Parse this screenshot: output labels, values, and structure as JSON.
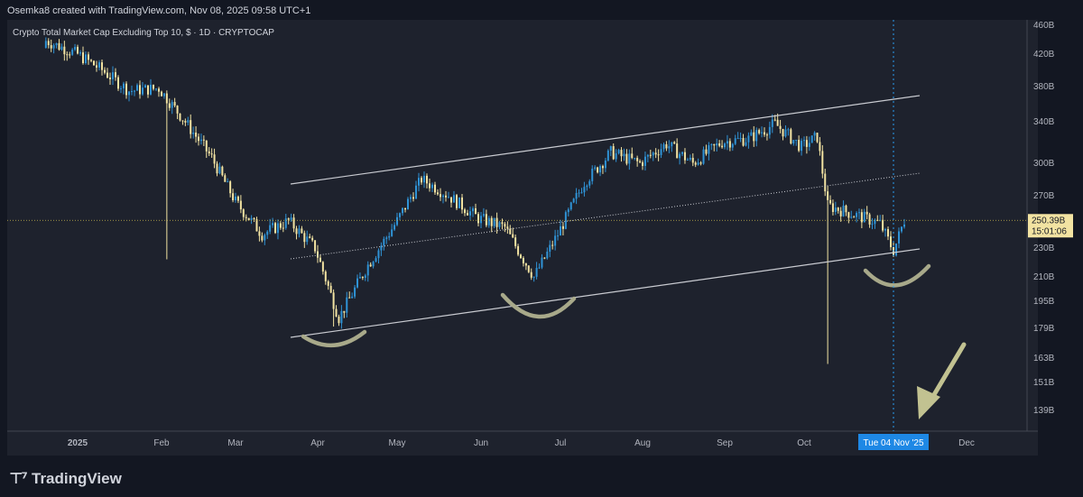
{
  "header": {
    "attribution": "Osemka8 created with TradingView.com, Nov 08, 2025 09:58 UTC+1"
  },
  "brand": {
    "name": "TradingView"
  },
  "colors": {
    "up": "#2f93d6",
    "down": "#f2e3a2",
    "channel": "#c9cbd1",
    "annotation": "#a8a98a",
    "price_line": "#c7b84e",
    "cursor": "#2a9df4"
  },
  "chart_data": {
    "type": "candlestick",
    "title": "Crypto Total Market Cap Excluding Top 10, $ · 1D · CRYPTOCAP",
    "y_ticks": [
      "460B",
      "420B",
      "380B",
      "340B",
      "300B",
      "270B",
      "230B",
      "210B",
      "195B",
      "179B",
      "163B",
      "151B",
      "139B"
    ],
    "y_scale": "log",
    "x_ticks": [
      "2025",
      "Feb",
      "Mar",
      "Apr",
      "May",
      "Jun",
      "Jul",
      "Aug",
      "Sep",
      "Oct",
      "Dec"
    ],
    "current_price": {
      "value": "250.39B",
      "countdown": "15:01:06"
    },
    "crosshair_date": "Tue 04 Nov '25",
    "close_series": [
      {
        "date": "2025-01-01",
        "value": 420
      },
      {
        "date": "2025-01-10",
        "value": 400
      },
      {
        "date": "2025-01-20",
        "value": 375
      },
      {
        "date": "2025-01-31",
        "value": 378
      },
      {
        "date": "2025-02-10",
        "value": 340
      },
      {
        "date": "2025-02-20",
        "value": 305
      },
      {
        "date": "2025-03-01",
        "value": 265
      },
      {
        "date": "2025-03-11",
        "value": 240
      },
      {
        "date": "2025-03-21",
        "value": 250
      },
      {
        "date": "2025-03-31",
        "value": 230
      },
      {
        "date": "2025-04-09",
        "value": 185
      },
      {
        "date": "2025-04-20",
        "value": 218
      },
      {
        "date": "2025-05-01",
        "value": 250
      },
      {
        "date": "2025-05-10",
        "value": 285
      },
      {
        "date": "2025-05-20",
        "value": 270
      },
      {
        "date": "2025-05-31",
        "value": 252
      },
      {
        "date": "2025-06-10",
        "value": 245
      },
      {
        "date": "2025-06-21",
        "value": 210
      },
      {
        "date": "2025-06-30",
        "value": 240
      },
      {
        "date": "2025-07-10",
        "value": 282
      },
      {
        "date": "2025-07-20",
        "value": 310
      },
      {
        "date": "2025-07-31",
        "value": 300
      },
      {
        "date": "2025-08-10",
        "value": 318
      },
      {
        "date": "2025-08-20",
        "value": 300
      },
      {
        "date": "2025-08-31",
        "value": 320
      },
      {
        "date": "2025-09-10",
        "value": 323
      },
      {
        "date": "2025-09-20",
        "value": 338
      },
      {
        "date": "2025-09-30",
        "value": 315
      },
      {
        "date": "2025-10-06",
        "value": 325
      },
      {
        "date": "2025-10-10",
        "value": 262
      },
      {
        "date": "2025-10-20",
        "value": 255
      },
      {
        "date": "2025-10-30",
        "value": 248
      },
      {
        "date": "2025-11-04",
        "value": 228
      },
      {
        "date": "2025-11-08",
        "value": 250.39
      }
    ]
  }
}
